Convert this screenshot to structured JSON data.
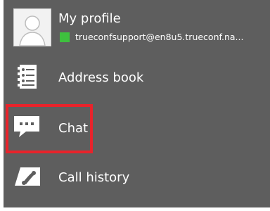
{
  "profile": {
    "title": "My profile",
    "email": "trueconfsupport@en8u5.trueconf.na...",
    "status_color": "#3ec03e",
    "avatar_icon": "user-avatar-icon"
  },
  "menu": {
    "items": [
      {
        "label": "Address book",
        "icon": "address-book-icon"
      },
      {
        "label": "Chat",
        "icon": "chat-icon"
      },
      {
        "label": "Call history",
        "icon": "call-history-icon"
      }
    ]
  },
  "colors": {
    "panel_bg": "#5e5e5e",
    "text": "#ffffff",
    "highlight": "#e8232b"
  }
}
